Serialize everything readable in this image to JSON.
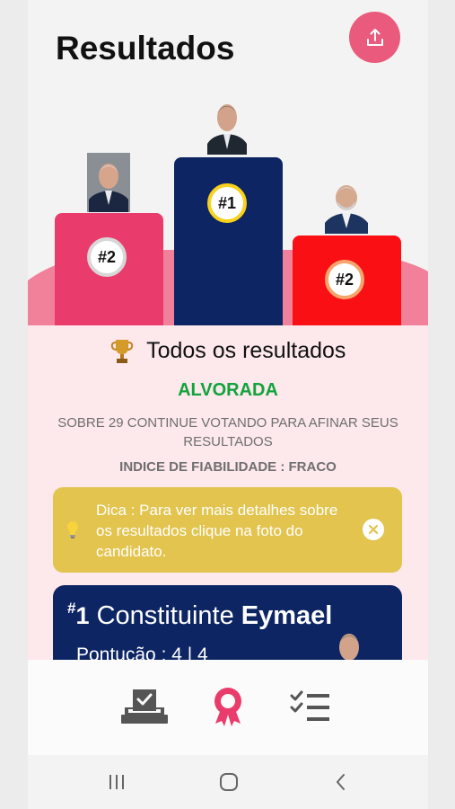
{
  "header": {
    "title": "Resultados",
    "share_icon": "share-upload-icon"
  },
  "podium": [
    {
      "place": 2,
      "rank_label": "#2",
      "color": "#ea3c6c"
    },
    {
      "place": 1,
      "rank_label": "#1",
      "color": "#0d2563"
    },
    {
      "place": 3,
      "rank_label": "#2",
      "color": "#f90f14"
    }
  ],
  "results": {
    "heading": "Todos os resultados",
    "heading_icon": "trophy-icon",
    "winner": "ALVORADA",
    "about": "SOBRE 29 CONTINUE VOTANDO PARA AFINAR SEUS RESULTADOS",
    "reliability": "INDICE DE FIABILIDADE : FRACO"
  },
  "tip": {
    "text": "Dica : Para ver mais detalhes sobre os resultados clique na foto do candidato.",
    "icon": "lightbulb-icon",
    "close_icon": "close-icon",
    "color": "#e2c44f"
  },
  "first_card": {
    "rank_symbol": "#",
    "rank_number": "1",
    "prefix": "Constituinte",
    "surname": "Eymael",
    "score": "Pontução : 4 | 4"
  },
  "bottom_nav": [
    {
      "icon": "vote-box-icon",
      "active": false
    },
    {
      "icon": "award-ribbon-icon",
      "active": true
    },
    {
      "icon": "checklist-icon",
      "active": false
    }
  ],
  "colors": {
    "accent": "#ea5a7c",
    "winner": "#12a33c",
    "navy": "#0d2563"
  }
}
